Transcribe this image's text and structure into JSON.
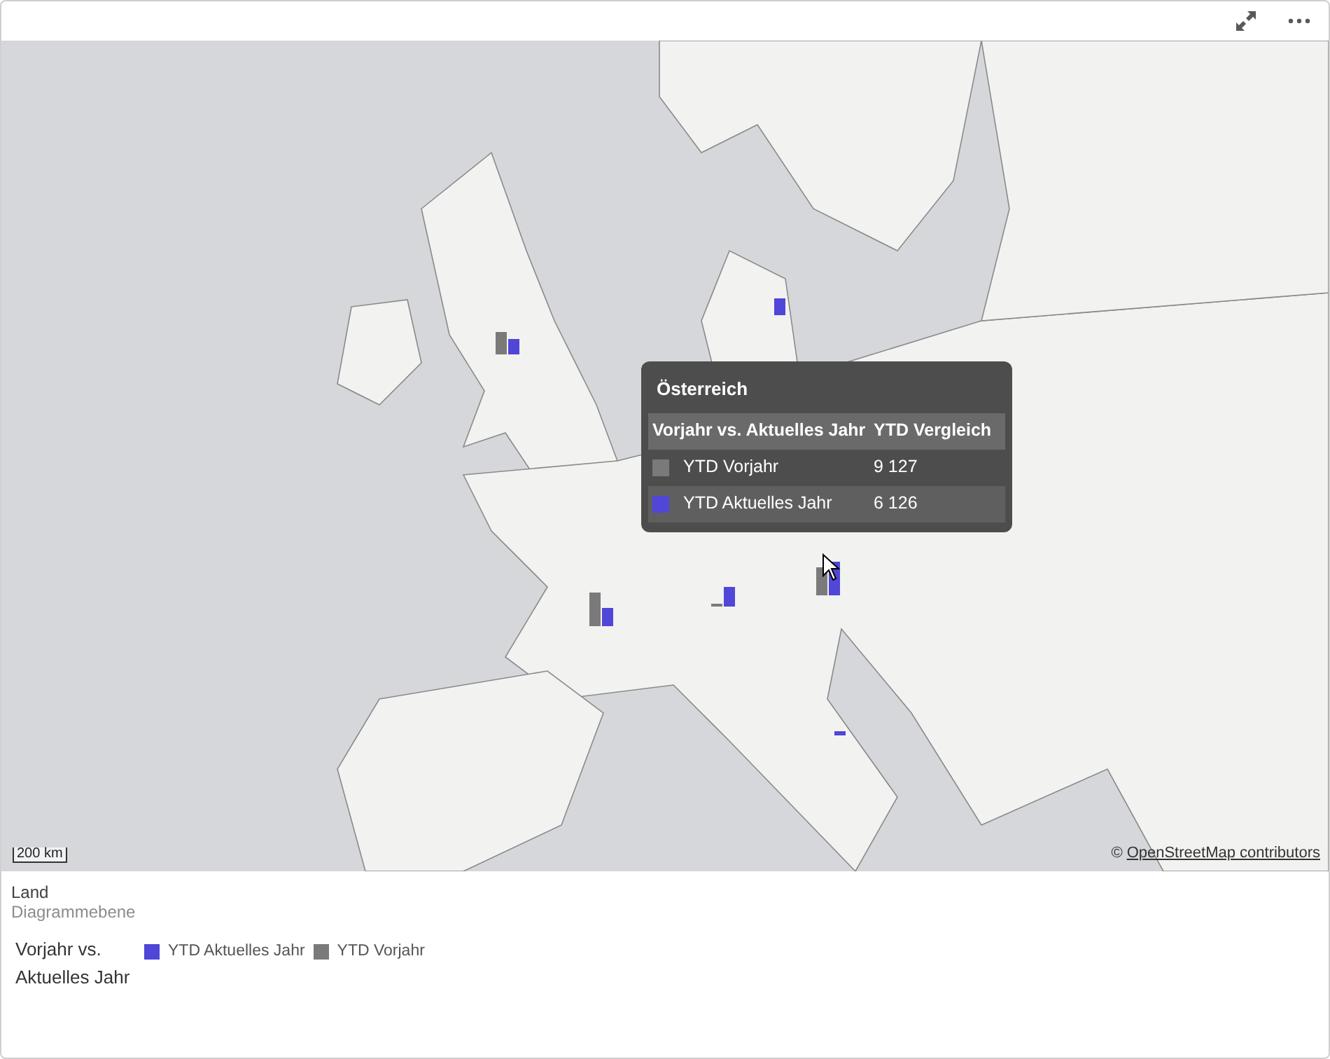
{
  "map": {
    "scale": "200 km",
    "attribution_symbol": "©",
    "attribution_link": "OpenStreetMap contributors"
  },
  "tooltip": {
    "title": "Österreich",
    "columns": [
      "Vorjahr vs. Aktuelles Jahr",
      "YTD Vergleich"
    ],
    "rows": [
      {
        "label": "YTD Vorjahr",
        "value": "9 127",
        "color": "#7a7a7a"
      },
      {
        "label": "YTD Aktuelles Jahr",
        "value": "6 126",
        "color": "#5046d8"
      }
    ]
  },
  "legend": {
    "dimension": "Land",
    "layer": "Diagrammebene",
    "measure_title": "Vorjahr vs. Aktuelles Jahr",
    "items": [
      {
        "label": "YTD Aktuelles Jahr",
        "color": "#5046d8"
      },
      {
        "label": "YTD Vorjahr",
        "color": "#7a7a7a"
      }
    ]
  }
}
